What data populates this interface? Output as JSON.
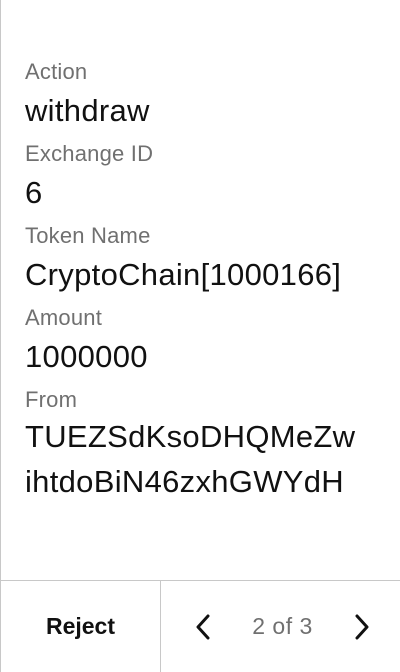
{
  "fields": [
    {
      "label": "Action",
      "value": "withdraw"
    },
    {
      "label": "Exchange ID",
      "value": "6"
    },
    {
      "label": "Token Name",
      "value": "CryptoChain[1000166]"
    },
    {
      "label": "Amount",
      "value": "1000000"
    },
    {
      "label": "From",
      "value_line1": "TUEZSdKsoDHQMeZw",
      "value_line2": "ihtdoBiN46zxhGWYdH"
    }
  ],
  "footer": {
    "reject_label": "Reject",
    "pager_text": "2 of 3",
    "prev_icon": "chevron-left-icon",
    "next_icon": "chevron-right-icon"
  },
  "colors": {
    "label": "#707070",
    "value": "#111111",
    "divider": "#c8c8c8"
  }
}
